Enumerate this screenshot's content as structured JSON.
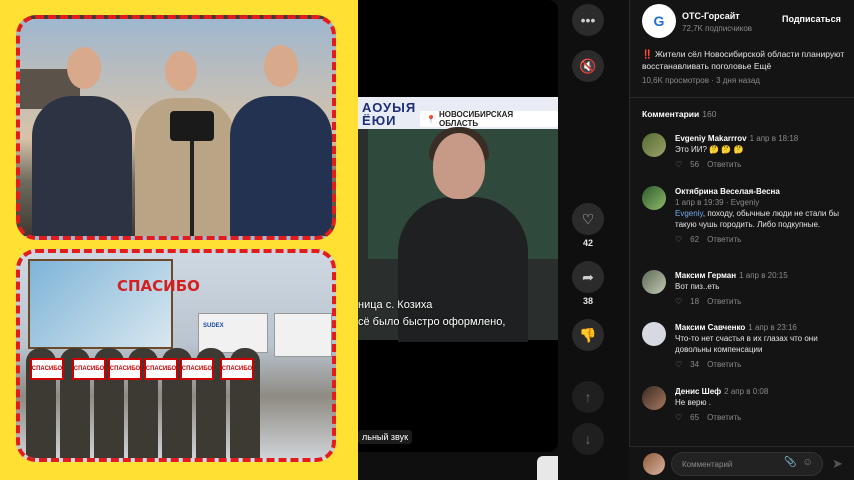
{
  "promo": {
    "billboard_text": "СПАСИБО",
    "sign_text": "СПАСИБО",
    "truck_text": "SUDEX",
    "colors": {
      "background": "#ffe033",
      "border": "#e21c1c"
    }
  },
  "video": {
    "banner_letters": "АОУЫЯЁЮИ",
    "region_label": "НОВОСИБИРСКАЯ ОБЛАСТЬ",
    "subtitle_line1": "ница с. Козиха",
    "subtitle_line2": "сё было быстро оформлено,",
    "original_sound": "льный звук"
  },
  "actions": {
    "more_icon": "more-icon",
    "mute_icon": "mute-icon",
    "likes": "42",
    "shares": "38",
    "dislike_icon": "dislike-icon",
    "up_icon": "arrow-up-icon",
    "down_icon": "arrow-down-icon"
  },
  "channel": {
    "name": "ОТС-Горсайт",
    "subscribers": "72,7K подписчиков",
    "subscribe_label": "Подписаться",
    "post_text": "‼️ Жители сёл Новосибирской области планируют восстанавливать поголовье Ещё",
    "views": "10,6K просмотров",
    "time": "3 дня назад"
  },
  "comments": {
    "title": "Комментарии",
    "count": "160",
    "items": [
      {
        "name": "Evgeniy Makarrrov",
        "time": "1 апр в 18:18",
        "text": "Это ИИ? 🤔 🤔 🤔",
        "likes": "56",
        "reply": "Ответить"
      },
      {
        "name": "Октябрина Веселая-Весна",
        "time": "1 апр в 19:39 · Evgeniy",
        "mention": "Evgeniy",
        "text": ", походу, обычные люди не стали бы такую чушь городить. Либо подкупные.",
        "likes": "62",
        "reply": "Ответить"
      },
      {
        "name": "Максим Герман",
        "time": "1 апр в 20:15",
        "text": "Вот пиз..еть",
        "likes": "18",
        "reply": "Ответить"
      },
      {
        "name": "Максим Савченко",
        "time": "1 апр в 23:16",
        "text": "Что-то нет счастья в их глазах что они довольны компенсации",
        "likes": "34",
        "reply": "Ответить"
      },
      {
        "name": "Денис Шеф",
        "time": "2 апр в 0:08",
        "text": "Не верю .",
        "likes": "65",
        "reply": "Ответить"
      }
    ]
  },
  "composer": {
    "placeholder": "Комментарий"
  }
}
